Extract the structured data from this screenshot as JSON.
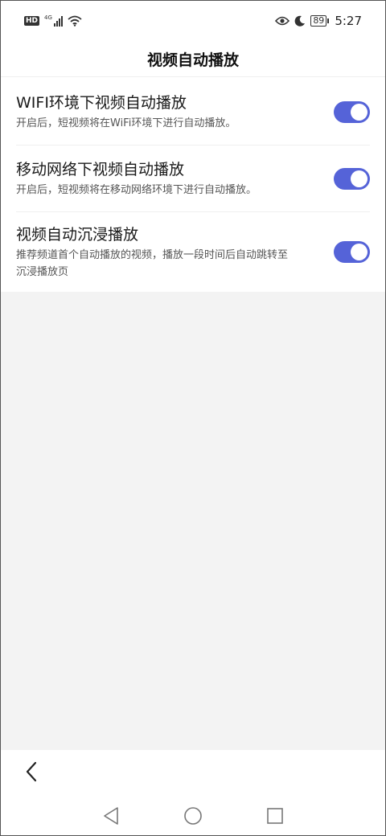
{
  "status_bar": {
    "hd": "HD",
    "network": "4G",
    "battery": "89",
    "time": "5:27"
  },
  "header": {
    "title": "视频自动播放"
  },
  "settings": [
    {
      "title": "WIFI环境下视频自动播放",
      "desc": "开启后，短视频将在WiFi环境下进行自动播放。",
      "enabled": true
    },
    {
      "title": "移动网络下视频自动播放",
      "desc": "开启后，短视频将在移动网络环境下进行自动播放。",
      "enabled": true
    },
    {
      "title": "视频自动沉浸播放",
      "desc": "推荐频道首个自动播放的视频，播放一段时间后自动跳转至沉浸播放页",
      "enabled": true
    }
  ],
  "colors": {
    "toggle_on": "#5563d8",
    "background": "#f3f3f3"
  },
  "icons": [
    "hd-icon",
    "signal-icon",
    "wifi-icon",
    "eye-icon",
    "moon-icon",
    "battery-icon",
    "back-arrow-icon",
    "nav-back-icon",
    "nav-home-icon",
    "nav-recents-icon"
  ]
}
